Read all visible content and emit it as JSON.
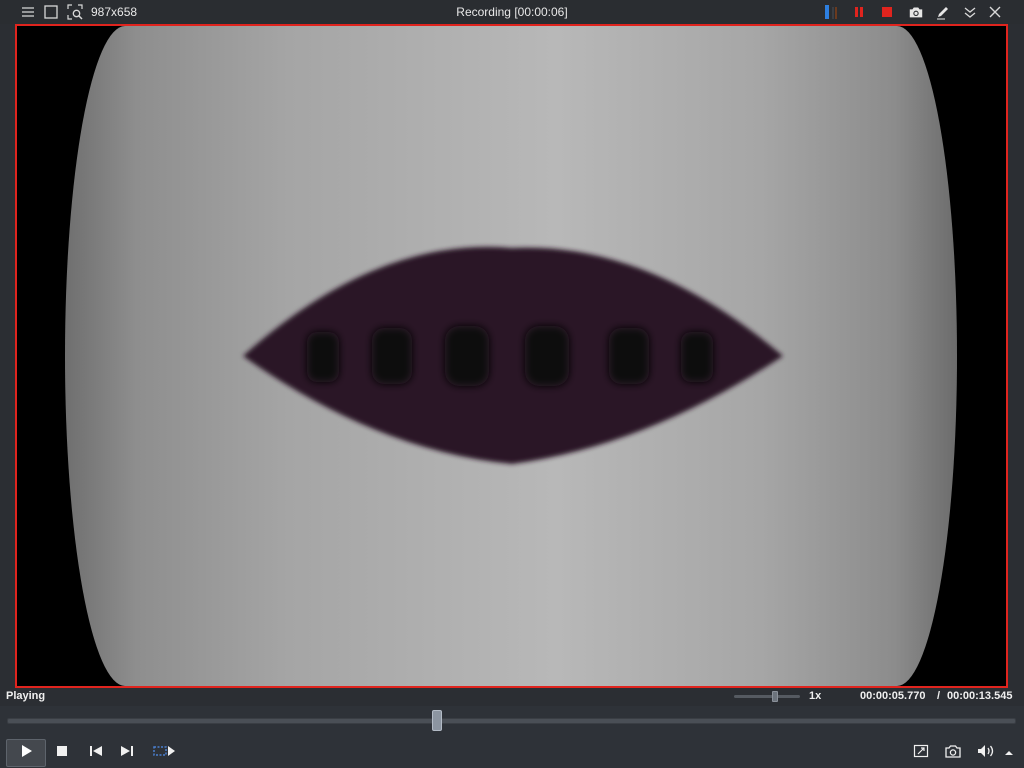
{
  "topbar": {
    "size_label": "987x658",
    "title": "Recording [00:00:06]",
    "icons": [
      "menu-icon",
      "region-select-icon",
      "zoom-region-icon",
      "level-meter-icon",
      "pause-icon",
      "stop-icon",
      "camera-icon",
      "pen-icon",
      "collapse-icon",
      "close-icon"
    ]
  },
  "status": {
    "state": "Playing",
    "speed": "1x",
    "speed_level": 0.62,
    "time_current": "00:00:05.770",
    "time_separator": "/",
    "time_total": "00:00:13.545"
  },
  "seek": {
    "position_fraction": 0.426
  },
  "colors": {
    "capture_border": "#e0241e",
    "record_red": "#e0241e",
    "meter_blue": "#2d7fe0",
    "video_shape": "#2a1526"
  },
  "controls": {
    "icons": [
      "play-icon",
      "stop-icon",
      "previous-frame-icon",
      "next-frame-icon",
      "loop-icon",
      "fit-window-icon",
      "snapshot-icon",
      "volume-icon",
      "expand-up-icon"
    ]
  }
}
